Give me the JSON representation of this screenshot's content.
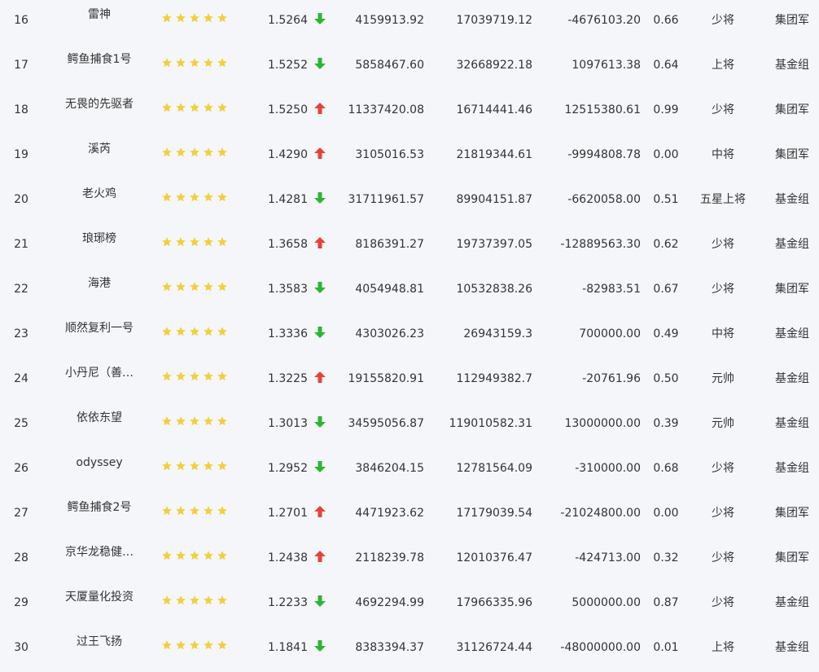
{
  "colors": {
    "background": "#f5f6fa",
    "text": "#333333",
    "star": "#f2d03b",
    "arrow_up": "#e8413a",
    "arrow_down": "#2bb534"
  },
  "rows": [
    {
      "rank": "16",
      "name": "雷神",
      "stars": 5,
      "nav": "1.5264",
      "trend": "down",
      "a": "4159913.92",
      "b": "17039719.12",
      "c": "-4676103.20",
      "r": "0.66",
      "level": "少将",
      "group": "集团军"
    },
    {
      "rank": "17",
      "name": "鳄鱼捕食1号",
      "stars": 5,
      "nav": "1.5252",
      "trend": "down",
      "a": "5858467.60",
      "b": "32668922.18",
      "c": "1097613.38",
      "r": "0.64",
      "level": "上将",
      "group": "基金组"
    },
    {
      "rank": "18",
      "name": "无畏的先驱者",
      "stars": 5,
      "nav": "1.5250",
      "trend": "up",
      "a": "11337420.08",
      "b": "16714441.46",
      "c": "12515380.61",
      "r": "0.99",
      "level": "少将",
      "group": "集团军"
    },
    {
      "rank": "19",
      "name": "溪芮",
      "stars": 5,
      "nav": "1.4290",
      "trend": "up",
      "a": "3105016.53",
      "b": "21819344.61",
      "c": "-9994808.78",
      "r": "0.00",
      "level": "中将",
      "group": "集团军"
    },
    {
      "rank": "20",
      "name": "老火鸡",
      "stars": 5,
      "nav": "1.4281",
      "trend": "down",
      "a": "31711961.57",
      "b": "89904151.87",
      "c": "-6620058.00",
      "r": "0.51",
      "level": "五星上将",
      "group": "基金组"
    },
    {
      "rank": "21",
      "name": "琅琊榜",
      "stars": 5,
      "nav": "1.3658",
      "trend": "up",
      "a": "8186391.27",
      "b": "19737397.05",
      "c": "-12889563.30",
      "r": "0.62",
      "level": "少将",
      "group": "基金组"
    },
    {
      "rank": "22",
      "name": "海港",
      "stars": 5,
      "nav": "1.3583",
      "trend": "down",
      "a": "4054948.81",
      "b": "10532838.26",
      "c": "-82983.51",
      "r": "0.67",
      "level": "少将",
      "group": "集团军"
    },
    {
      "rank": "23",
      "name": "顺然复利一号",
      "stars": 5,
      "nav": "1.3336",
      "trend": "down",
      "a": "4303026.23",
      "b": "26943159.3",
      "c": "700000.00",
      "r": "0.49",
      "level": "中将",
      "group": "基金组"
    },
    {
      "rank": "24",
      "name": "小丹尼（善…",
      "stars": 5,
      "nav": "1.3225",
      "trend": "up",
      "a": "19155820.91",
      "b": "112949382.7",
      "c": "-20761.96",
      "r": "0.50",
      "level": "元帅",
      "group": "基金组"
    },
    {
      "rank": "25",
      "name": "依依东望",
      "stars": 5,
      "nav": "1.3013",
      "trend": "down",
      "a": "34595056.87",
      "b": "119010582.31",
      "c": "13000000.00",
      "r": "0.39",
      "level": "元帅",
      "group": "基金组"
    },
    {
      "rank": "26",
      "name": "odyssey",
      "stars": 5,
      "nav": "1.2952",
      "trend": "down",
      "a": "3846204.15",
      "b": "12781564.09",
      "c": "-310000.00",
      "r": "0.68",
      "level": "少将",
      "group": "基金组"
    },
    {
      "rank": "27",
      "name": "鳄鱼捕食2号",
      "stars": 5,
      "nav": "1.2701",
      "trend": "up",
      "a": "4471923.62",
      "b": "17179039.54",
      "c": "-21024800.00",
      "r": "0.00",
      "level": "少将",
      "group": "集团军"
    },
    {
      "rank": "28",
      "name": "京华龙稳健…",
      "stars": 5,
      "nav": "1.2438",
      "trend": "up",
      "a": "2118239.78",
      "b": "12010376.47",
      "c": "-424713.00",
      "r": "0.32",
      "level": "少将",
      "group": "集团军"
    },
    {
      "rank": "29",
      "name": "天厦量化投资",
      "stars": 5,
      "nav": "1.2233",
      "trend": "down",
      "a": "4692294.99",
      "b": "17966335.96",
      "c": "5000000.00",
      "r": "0.87",
      "level": "少将",
      "group": "基金组"
    },
    {
      "rank": "30",
      "name": "过王飞扬",
      "stars": 5,
      "nav": "1.1841",
      "trend": "down",
      "a": "8383394.37",
      "b": "31126724.44",
      "c": "-48000000.00",
      "r": "0.01",
      "level": "上将",
      "group": "基金组"
    }
  ]
}
